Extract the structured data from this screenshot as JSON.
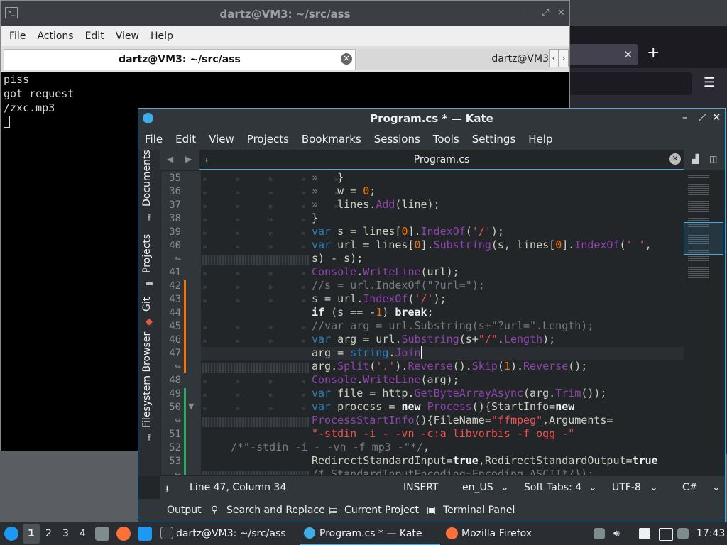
{
  "terminal": {
    "title": "dartz@VM3: ~/src/ass",
    "menu": [
      "File",
      "Actions",
      "Edit",
      "View",
      "Help"
    ],
    "tab_active": "dartz@VM3: ~/src/ass",
    "tab_inactive": "dartz@VM3",
    "output": [
      "piss",
      "got request",
      "/zxc.mp3"
    ]
  },
  "kate": {
    "title": "Program.cs * — Kate",
    "menu": [
      "File",
      "Edit",
      "View",
      "Projects",
      "Bookmarks",
      "Sessions",
      "Tools",
      "Settings",
      "Help"
    ],
    "sidebar": [
      "Documents",
      "Projects",
      "Git",
      "Filesystem Browser"
    ],
    "doc_tab": "Program.cs",
    "line_numbers": [
      "35",
      "36",
      "37",
      "38",
      "39",
      "40",
      "41",
      "42",
      "43",
      "44",
      "45",
      "46",
      "47",
      "48",
      "49",
      "50",
      "51",
      "52",
      "53"
    ],
    "status": {
      "position": "Line 47, Column 34",
      "mode": "INSERT",
      "language_dict": "en_US",
      "indent": "Soft Tabs: 4",
      "encoding": "UTF-8",
      "syntax": "C#"
    },
    "toolviews": [
      "Output",
      "Search and Replace",
      "Current Project",
      "Terminal Panel"
    ]
  },
  "taskbar": {
    "workspaces": [
      "1",
      "2",
      "3",
      "4"
    ],
    "tasks": [
      "dartz@VM3: ~/src/ass",
      "Program.cs * — Kate",
      "Mozilla Firefox"
    ],
    "clock": "17:43"
  }
}
